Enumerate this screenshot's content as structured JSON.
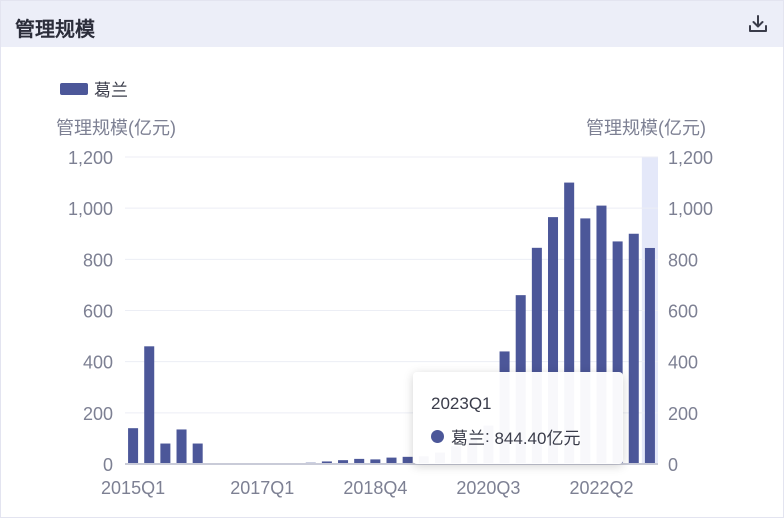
{
  "header": {
    "title": "管理规模",
    "download_icon": "download-icon"
  },
  "legend": {
    "label": "葛兰",
    "color": "#4c5799"
  },
  "axes": {
    "left_title": "管理规模(亿元)",
    "right_title": "管理规模(亿元)"
  },
  "tooltip": {
    "title": "2023Q1",
    "series": "葛兰",
    "value_text": "844.40亿元"
  },
  "chart_data": {
    "type": "bar",
    "categories": [
      "2015Q1",
      "2015Q2",
      "2015Q3",
      "2015Q4",
      "2016Q1",
      "2016Q2",
      "2016Q3",
      "2016Q4",
      "2017Q1",
      "2017Q2",
      "2017Q3",
      "2017Q4",
      "2018Q1",
      "2018Q2",
      "2018Q3",
      "2018Q4",
      "2019Q1",
      "2019Q2",
      "2019Q3",
      "2019Q4",
      "2020Q1",
      "2020Q2",
      "2020Q3",
      "2020Q4",
      "2021Q1",
      "2021Q2",
      "2021Q3",
      "2021Q4",
      "2022Q1",
      "2022Q2",
      "2022Q3",
      "2022Q4",
      "2023Q1"
    ],
    "x_tick_labels": [
      "2015Q1",
      "2017Q1",
      "2018Q4",
      "2020Q3",
      "2022Q2"
    ],
    "series": [
      {
        "name": "葛兰",
        "color": "#4c5799",
        "values": [
          140,
          460,
          80,
          135,
          80,
          3,
          3,
          3,
          3,
          3,
          3,
          5,
          10,
          15,
          20,
          18,
          25,
          28,
          30,
          45,
          70,
          100,
          150,
          440,
          660,
          845,
          965,
          1100,
          960,
          1010,
          870,
          900,
          844.4
        ]
      }
    ],
    "ylim": [
      0,
      1200
    ],
    "y_ticks": [
      0,
      200,
      400,
      600,
      800,
      1000,
      1200
    ],
    "y_tick_labels": [
      "0",
      "200",
      "400",
      "600",
      "800",
      "1,000",
      "1,200"
    ],
    "highlight_category": "2023Q1",
    "grid": true
  }
}
